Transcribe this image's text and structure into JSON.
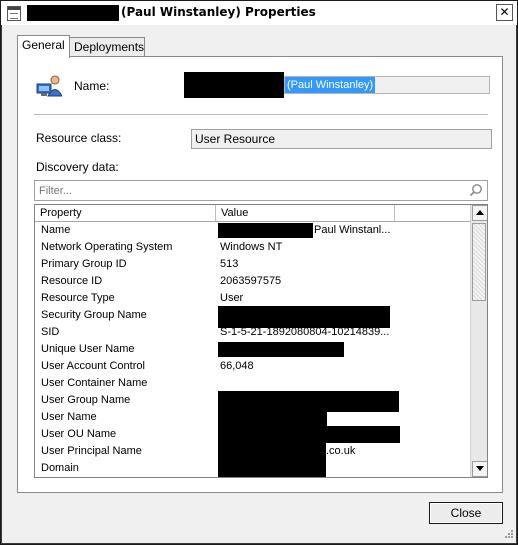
{
  "window": {
    "title": "(Paul Winstanley) Properties",
    "close_glyph": "✕"
  },
  "tabs": [
    {
      "label": "General",
      "active": true
    },
    {
      "label": "Deployments",
      "active": false
    }
  ],
  "general": {
    "name_label": "Name:",
    "name_value": "(Paul Winstanley)",
    "resource_class_label": "Resource class:",
    "resource_class_value": "User Resource",
    "discovery_label": "Discovery data:",
    "filter_placeholder": "Filter..."
  },
  "table": {
    "columns": [
      "Property",
      "Value"
    ],
    "rows": [
      {
        "property": "Name",
        "value": "Paul Winstanl..."
      },
      {
        "property": "Network Operating System",
        "value": "Windows NT"
      },
      {
        "property": "Primary Group ID",
        "value": "513"
      },
      {
        "property": "Resource ID",
        "value": "2063597575"
      },
      {
        "property": "Resource Type",
        "value": "User"
      },
      {
        "property": "Security Group Name",
        "value": ""
      },
      {
        "property": "SID",
        "value": "S-1-5-21-1892080804-10214839..."
      },
      {
        "property": "Unique User Name",
        "value": ""
      },
      {
        "property": "User Account Control",
        "value": "66,048"
      },
      {
        "property": "User Container Name",
        "value": ""
      },
      {
        "property": "User Group Name",
        "value": ""
      },
      {
        "property": "User Name",
        "value": ""
      },
      {
        "property": "User OU Name",
        "value": ""
      },
      {
        "property": "User Principal Name",
        "value": ".co.uk"
      },
      {
        "property": "Domain",
        "value": ""
      }
    ]
  },
  "buttons": {
    "close": "Close"
  },
  "colors": {
    "selection": "#3399ff",
    "redaction": "#000000"
  }
}
